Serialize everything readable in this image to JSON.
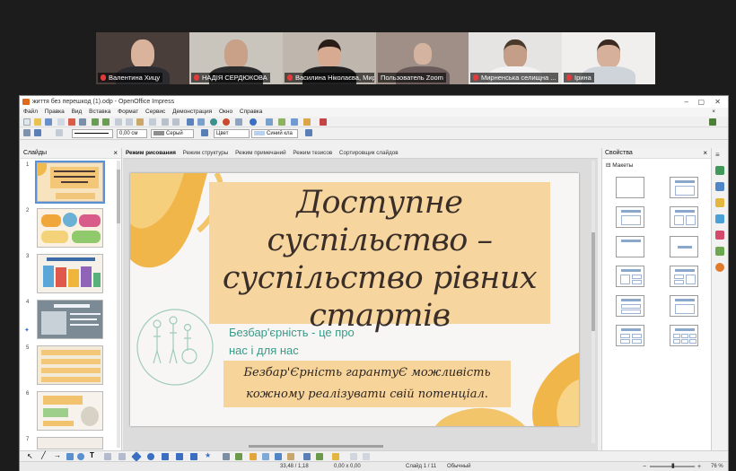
{
  "participants": [
    {
      "name": "Валентина Хицу",
      "active": false
    },
    {
      "name": "НАДІЯ СЕРДЮКОВА",
      "active": false
    },
    {
      "name": "Василина Ніколаєва, Мир...",
      "active": true
    },
    {
      "name": "Пользователь Zoom",
      "active": false
    },
    {
      "name": "Мирненська селищна ...",
      "active": false
    },
    {
      "name": "Ірина",
      "active": false
    }
  ],
  "window": {
    "title": "життя без перешкод (1).odp - OpenOffice Impress",
    "controls": [
      "–",
      "▢",
      "✕"
    ]
  },
  "menu": [
    "Файл",
    "Правка",
    "Вид",
    "Вставка",
    "Формат",
    "Сервис",
    "Демонстрация",
    "Окно",
    "Справка"
  ],
  "toolbar2": {
    "line_width": "0,00 см",
    "line_color": "Серый",
    "area_mode": "Цвет",
    "area_color": "Синий кла"
  },
  "slides_pane": {
    "title": "Слайды",
    "numbers": [
      "1",
      "2",
      "3",
      "4",
      "5",
      "6",
      "7"
    ]
  },
  "view_tabs": [
    "Режим рисования",
    "Режим структуры",
    "Режим примечаний",
    "Режим тезисов",
    "Сортировщик слайдов"
  ],
  "slide": {
    "title": "Доступне суспільство – суспільство рівних стартів",
    "subtitle": "Безбар'єрність - це про нас і для нас",
    "box_text": "Безбар'Єрність гарантуЄ можливість кожному реалізувати свій потенціал."
  },
  "properties": {
    "title": "Свойства",
    "section": "Макеты"
  },
  "status": {
    "position": "33,48 / 1,18",
    "size": "0,00 x 0,00",
    "slide": "Слайд 1 / 11",
    "layout": "Обычный",
    "zoom": "76 %"
  }
}
